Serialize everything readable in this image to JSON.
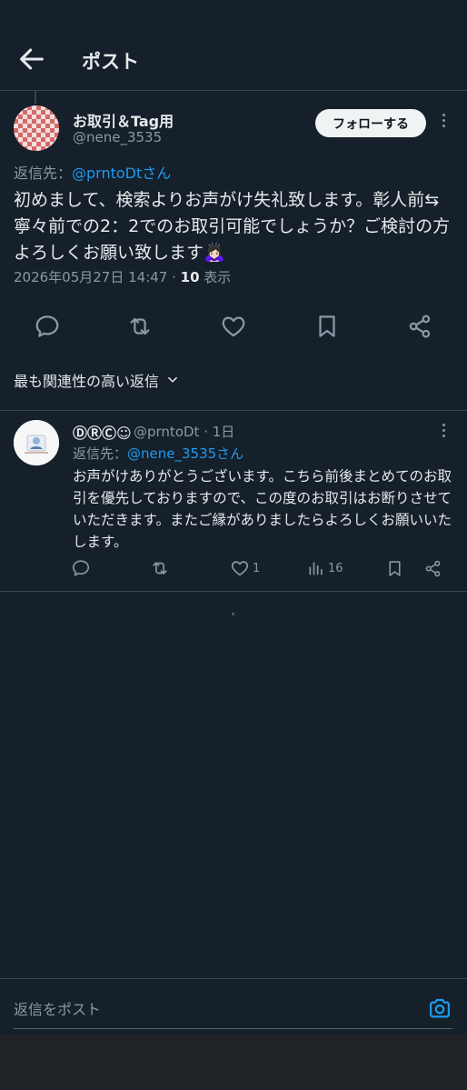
{
  "header": {
    "title": "ポスト"
  },
  "main_post": {
    "author_name": "お取引＆Tag用",
    "author_handle": "@nene_3535",
    "follow_label": "フォローする",
    "reply_to_label": "返信先：",
    "reply_to_mention": "@prntoDtさん",
    "body": "初めまして、検索よりお声がけ失礼致します。彰人前⇆寧々前での2：2でのお取引可能でしょうか？ご検討の方よろしくお願い致します🙇🏻‍♀️",
    "timestamp": "2026年05月27日 14:47",
    "separator": " · ",
    "views_count": "10",
    "views_label": " 表示",
    "actions": [
      "reply-icon",
      "retweet-icon",
      "like-icon",
      "bookmark-icon",
      "share-icon"
    ]
  },
  "sort": {
    "label": "最も関連性の高い返信"
  },
  "reply": {
    "author_name": "ⒹⓇⒸ☺",
    "author_handle": "@prntoDt · 1日",
    "reply_to_label": "返信先：",
    "reply_to_mention": "@nene_3535さん",
    "body": "お声がけありがとうございます。こちら前後まとめてのお取引を優先しておりますので、この度のお取引はお断りさせていただきます。またご縁がありましたらよろしくお願いいたします。",
    "like_count": "1",
    "view_count": "16"
  },
  "composer": {
    "placeholder": "返信をポスト"
  },
  "colors": {
    "background": "#15202b",
    "accent": "#1d9bf0",
    "secondary_text": "#8b98a5",
    "divider": "#38444d"
  }
}
